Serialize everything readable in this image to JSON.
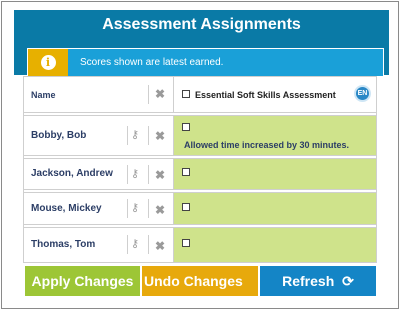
{
  "panel": {
    "title": "Assessment Assignments",
    "info_icon": "info-icon",
    "info_glyph": "i",
    "info_text": "Scores shown are latest earned."
  },
  "table": {
    "name_header": "Name",
    "assessment_header": "Essential Soft Skills Assessment",
    "language_badge": "EN",
    "rows": [
      {
        "name": "Bobby, Bob",
        "note": "Allowed time increased by 30 minutes."
      },
      {
        "name": "Jackson, Andrew",
        "note": ""
      },
      {
        "name": "Mouse, Mickey",
        "note": ""
      },
      {
        "name": "Thomas, Tom",
        "note": ""
      }
    ]
  },
  "glyphs": {
    "key": "⚷",
    "close": "✖",
    "refresh": "⟳"
  },
  "actions": {
    "apply": "Apply Changes",
    "undo": "Undo Changes",
    "refresh": "Refresh"
  },
  "colors": {
    "header": "#0a7aa6",
    "info_bar": "#1aa0d8",
    "info_icon_bg": "#e7b000",
    "assessment_cell": "#cfe38b",
    "apply": "#9dc636",
    "undo": "#e7a90c",
    "refresh": "#1485c6"
  }
}
